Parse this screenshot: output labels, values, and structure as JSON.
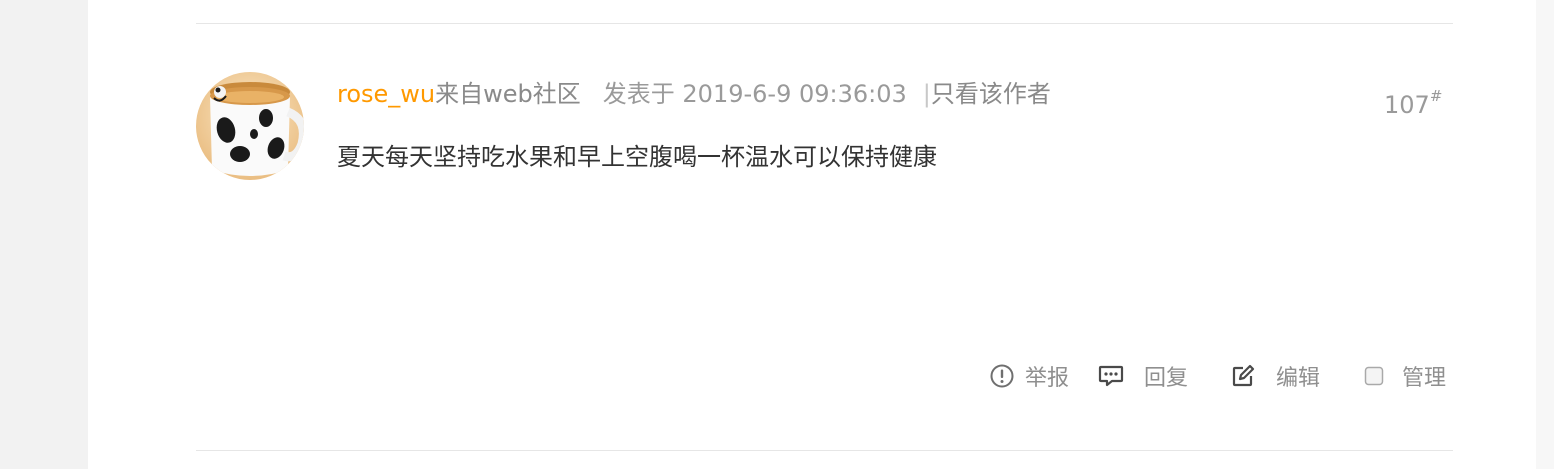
{
  "post": {
    "username": "rose_wu",
    "source": "来自web社区",
    "posted_at": "发表于 2019-6-9 09:36:03",
    "separator": "|",
    "only_author": "只看该作者",
    "floor_number": "107",
    "floor_suffix": "#",
    "content": "夏天每天坚持吃水果和早上空腹喝一杯温水可以保持健康"
  },
  "actions": {
    "report": "举报",
    "reply": "回复",
    "edit": "编辑",
    "manage": "管理"
  },
  "icons": {
    "report": "exclamation-circle-icon",
    "reply": "speech-bubble-icon",
    "edit": "pencil-square-icon",
    "manage": "checkbox-icon"
  },
  "colors": {
    "username": "#ff9900",
    "meta_text": "#8a8a8a",
    "content_text": "#333333",
    "divider": "#e6e6e6"
  }
}
